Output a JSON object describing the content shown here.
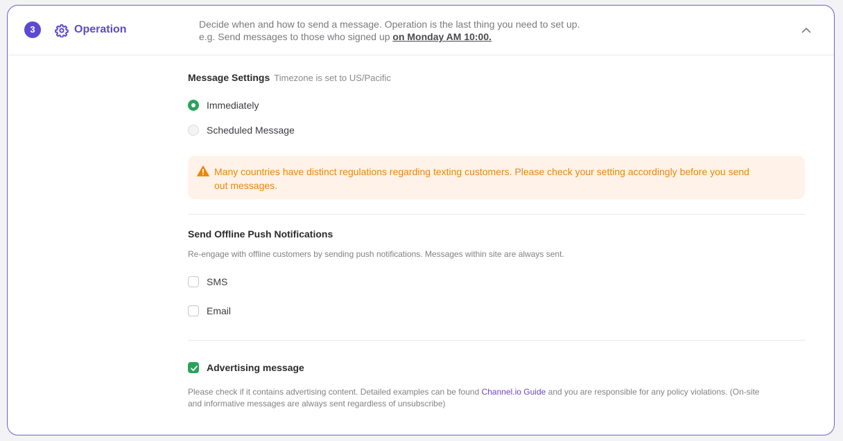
{
  "header": {
    "step_number": "3",
    "title": "Operation",
    "description_line1": "Decide when and how to send a message. Operation is the last thing you need to set up.",
    "description_line2_prefix": "e.g. Send messages to those who signed up ",
    "description_line2_emphasis": "on Monday AM 10:00."
  },
  "message_settings": {
    "title": "Message Settings",
    "timezone_note": "Timezone is set to US/Pacific",
    "options": [
      {
        "label": "Immediately",
        "selected": true
      },
      {
        "label": "Scheduled Message",
        "selected": false
      }
    ],
    "warning_line1": "Many countries have distinct regulations regarding texting customers. Please check your setting accordingly before you send",
    "warning_line2": "out messages."
  },
  "offline_push": {
    "title": "Send Offline Push Notifications",
    "description": "Re-engage with offline customers by sending push notifications. Messages within site are always sent.",
    "channels": [
      {
        "label": "SMS",
        "checked": false
      },
      {
        "label": "Email",
        "checked": false
      }
    ]
  },
  "advertising": {
    "label": "Advertising message",
    "checked": true,
    "description_prefix": "Please check if it contains advertising content. Detailed examples can be found ",
    "link_text": "Channel.io Guide",
    "description_suffix": " and you are responsible for any policy violations. (On-site",
    "description_line2": "and informative messages are always sent regardless of unsubscribe)"
  },
  "colors": {
    "accent": "#5b4ad1",
    "success": "#2aa35a",
    "warning_text": "#e9860c",
    "warning_bg": "#fff2e8"
  }
}
